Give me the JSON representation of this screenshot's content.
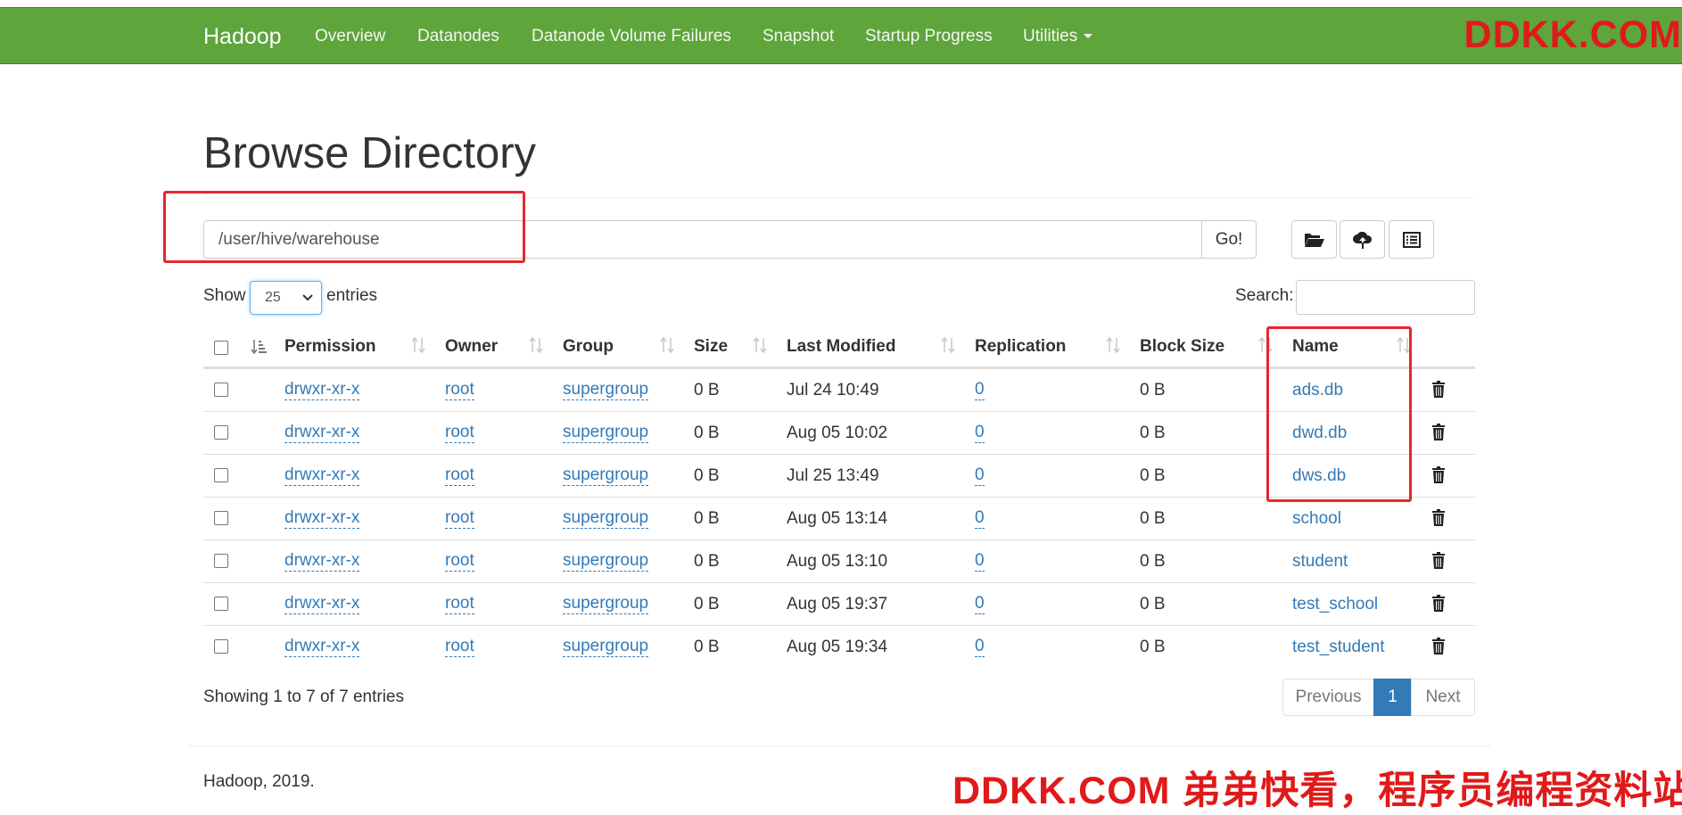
{
  "navbar": {
    "brand": "Hadoop",
    "items": [
      {
        "label": "Overview"
      },
      {
        "label": "Datanodes"
      },
      {
        "label": "Datanode Volume Failures"
      },
      {
        "label": "Snapshot"
      },
      {
        "label": "Startup Progress"
      },
      {
        "label": "Utilities"
      }
    ],
    "watermark": "DDKK.COM",
    "background_color": "#5ea53c"
  },
  "page": {
    "title": "Browse Directory",
    "path_value": "/user/hive/warehouse",
    "go_label": "Go!",
    "toolbar_icons": [
      "folder-open-icon",
      "cloud-upload-icon",
      "list-alt-icon"
    ]
  },
  "table_controls": {
    "show_label": "Show",
    "entries_value": "25",
    "entries_label": "entries",
    "search_label": "Search:",
    "search_value": ""
  },
  "table": {
    "columns": [
      "Permission",
      "Owner",
      "Group",
      "Size",
      "Last Modified",
      "Replication",
      "Block Size",
      "Name"
    ],
    "rows": [
      {
        "permission": "drwxr-xr-x",
        "owner": "root",
        "group": "supergroup",
        "size": "0 B",
        "modified": "Jul 24 10:49",
        "replication": "0",
        "block_size": "0 B",
        "name": "ads.db"
      },
      {
        "permission": "drwxr-xr-x",
        "owner": "root",
        "group": "supergroup",
        "size": "0 B",
        "modified": "Aug 05 10:02",
        "replication": "0",
        "block_size": "0 B",
        "name": "dwd.db"
      },
      {
        "permission": "drwxr-xr-x",
        "owner": "root",
        "group": "supergroup",
        "size": "0 B",
        "modified": "Jul 25 13:49",
        "replication": "0",
        "block_size": "0 B",
        "name": "dws.db"
      },
      {
        "permission": "drwxr-xr-x",
        "owner": "root",
        "group": "supergroup",
        "size": "0 B",
        "modified": "Aug 05 13:14",
        "replication": "0",
        "block_size": "0 B",
        "name": "school"
      },
      {
        "permission": "drwxr-xr-x",
        "owner": "root",
        "group": "supergroup",
        "size": "0 B",
        "modified": "Aug 05 13:10",
        "replication": "0",
        "block_size": "0 B",
        "name": "student"
      },
      {
        "permission": "drwxr-xr-x",
        "owner": "root",
        "group": "supergroup",
        "size": "0 B",
        "modified": "Aug 05 19:37",
        "replication": "0",
        "block_size": "0 B",
        "name": "test_school"
      },
      {
        "permission": "drwxr-xr-x",
        "owner": "root",
        "group": "supergroup",
        "size": "0 B",
        "modified": "Aug 05 19:34",
        "replication": "0",
        "block_size": "0 B",
        "name": "test_student"
      }
    ],
    "row_action_icon": "trash-icon",
    "link_color": "#337ab7"
  },
  "footer": {
    "summary": "Showing 1 to 7 of 7 entries",
    "pagination": {
      "previous": "Previous",
      "current": "1",
      "next": "Next"
    },
    "copyright": "Hadoop, 2019.",
    "watermark": "DDKK.COM 弟弟快看，程序员编程资料站"
  },
  "annotations": {
    "highlight_color": "#e6262e"
  }
}
